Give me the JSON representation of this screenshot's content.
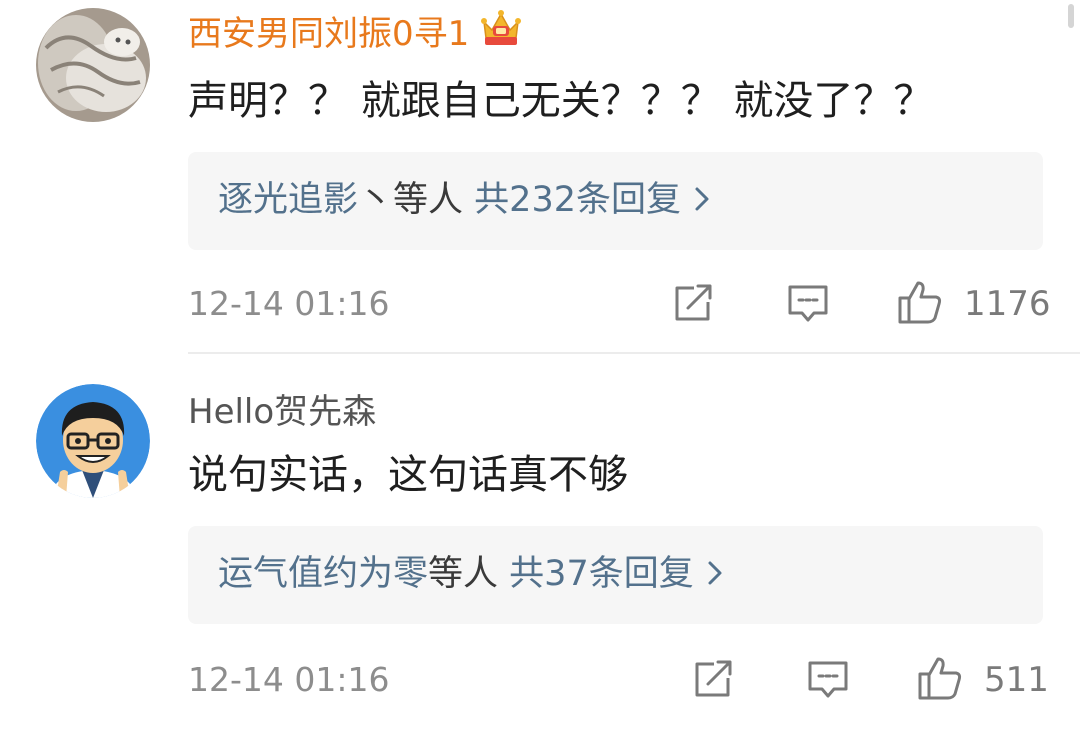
{
  "comments": [
    {
      "username": "西安男同刘振0寻1",
      "vip_badge": "crown-vip-icon",
      "content": "声明？？ 就跟自己无关？？？ 就没了？？",
      "replies": {
        "names": "逐光追影",
        "separator": "丶等人",
        "count_text": "共232条回复"
      },
      "timestamp": "12-14 01:16",
      "likes": "1176"
    },
    {
      "username": "Hello贺先森",
      "content": "说句实话，这句话真不够",
      "replies": {
        "names": "运气值约为零",
        "separator": "等人",
        "count_text": "共37条回复"
      },
      "timestamp": "12-14 01:16",
      "likes": "511"
    }
  ],
  "icons": {
    "share": "share-icon",
    "comment": "comment-icon",
    "like": "thumbs-up-icon",
    "chevron": "chevron-right-icon"
  },
  "colors": {
    "vip_name": "#e8791c",
    "reply_link": "#53718c",
    "muted": "#8d8d8d",
    "reply_bg": "#f6f6f6"
  }
}
